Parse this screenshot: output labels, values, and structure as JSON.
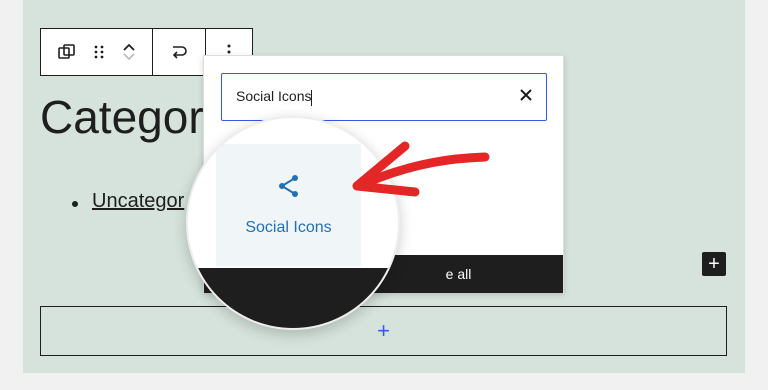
{
  "heading": "Categor",
  "list_items": [
    "Uncategor"
  ],
  "search": {
    "value": "Social Icons"
  },
  "browse_label": "e all",
  "block_result": {
    "label": "Social Icons",
    "icon": "share-icon"
  },
  "appender_label": "+",
  "small_plus": "+",
  "colors": {
    "canvas": "#d5e3dc",
    "accent": "#3858e9",
    "result_text": "#2271b1",
    "arrow": "#e32726"
  }
}
